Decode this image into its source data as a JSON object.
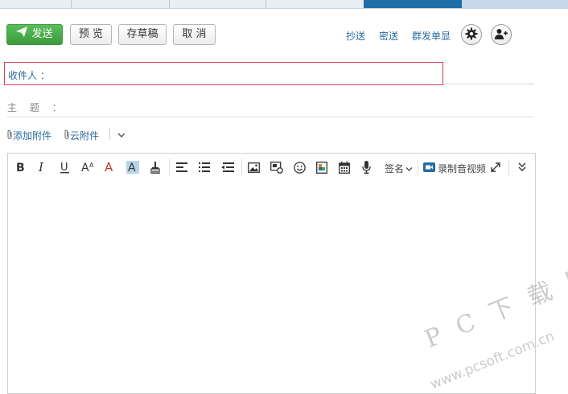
{
  "toolbar": {
    "send_label": "发送",
    "preview_label": "预 览",
    "draft_label": "存草稿",
    "cancel_label": "取 消",
    "cc_label": "抄送",
    "bcc_label": "密送",
    "separate_label": "群发单显",
    "settings_icon": "gear-icon",
    "contacts_icon": "add-contact-icon"
  },
  "compose": {
    "to_label": "收件人 ：",
    "subject_label": "主 题 ：",
    "attach_label": "添加附件",
    "cloud_attach_label": "云附件"
  },
  "editor": {
    "signature_label": "签名",
    "record_label": "录制音视频"
  },
  "watermark": {
    "brand": "P C 下 载 网",
    "url": "www.pcsoft.com.cn"
  },
  "colors": {
    "send_green": "#3b9b3b",
    "link_blue": "#2a6aa0",
    "highlight_red": "#d9424a",
    "active_tab": "#1f6ea8"
  }
}
